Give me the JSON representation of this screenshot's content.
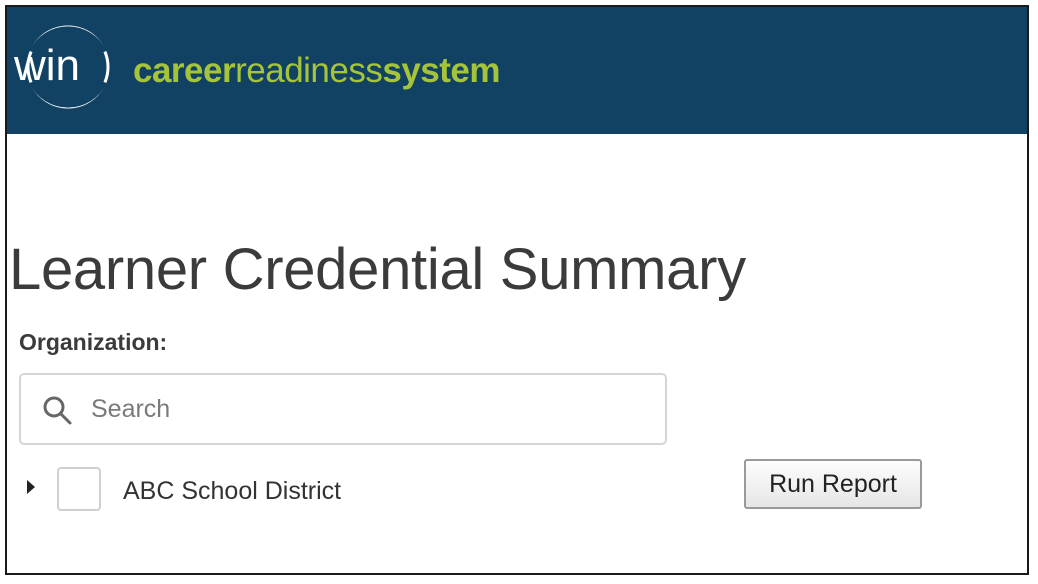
{
  "header": {
    "logo_text": "win",
    "brand": {
      "part1": "career",
      "part2": "readiness",
      "part3": "system"
    },
    "bg_color": "#124263",
    "brand_color": "#a6c43a"
  },
  "page": {
    "title": "Learner Credential Summary"
  },
  "organization": {
    "label": "Organization:",
    "search": {
      "placeholder": "Search",
      "value": "",
      "icon": "search-icon"
    },
    "tree": [
      {
        "label": "ABC School District",
        "expanded": false,
        "checked": false
      }
    ]
  },
  "actions": {
    "run_report_label": "Run Report"
  }
}
